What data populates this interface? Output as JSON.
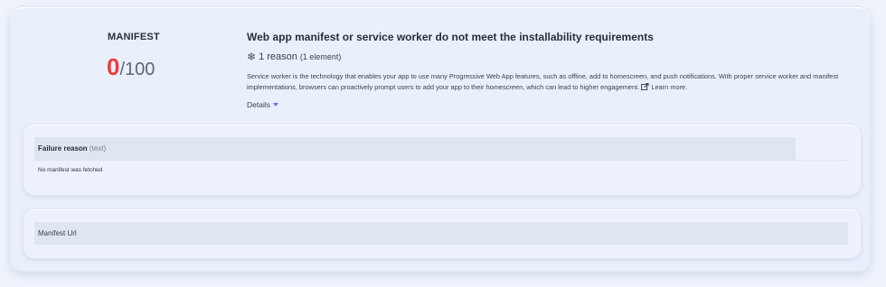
{
  "category": {
    "title": "MANIFEST",
    "score": "0",
    "score_max": "/100"
  },
  "audit": {
    "title": "Web app manifest or service worker do not meet the installability requirements",
    "reason_count": "1 reason",
    "reason_elements": "(1 element)",
    "description": "Service worker is the technology that enables your app to use many Progressive Web App features, such as offline, add to homescreen, and push notifications. With proper service worker and manifest implementations, browsers can proactively prompt users to add your app to their homescreen, which can lead to higher engagement.",
    "learn_more": "Learn more.",
    "details_label": "Details"
  },
  "failure_table": {
    "header": "Failure reason",
    "header_type": "(text)",
    "rows": [
      "No manifest was fetched"
    ]
  },
  "manifest_table": {
    "header": "Manifest Url"
  },
  "colors": {
    "score_fail": "#f03a3a",
    "caret": "#7a6ad8"
  }
}
